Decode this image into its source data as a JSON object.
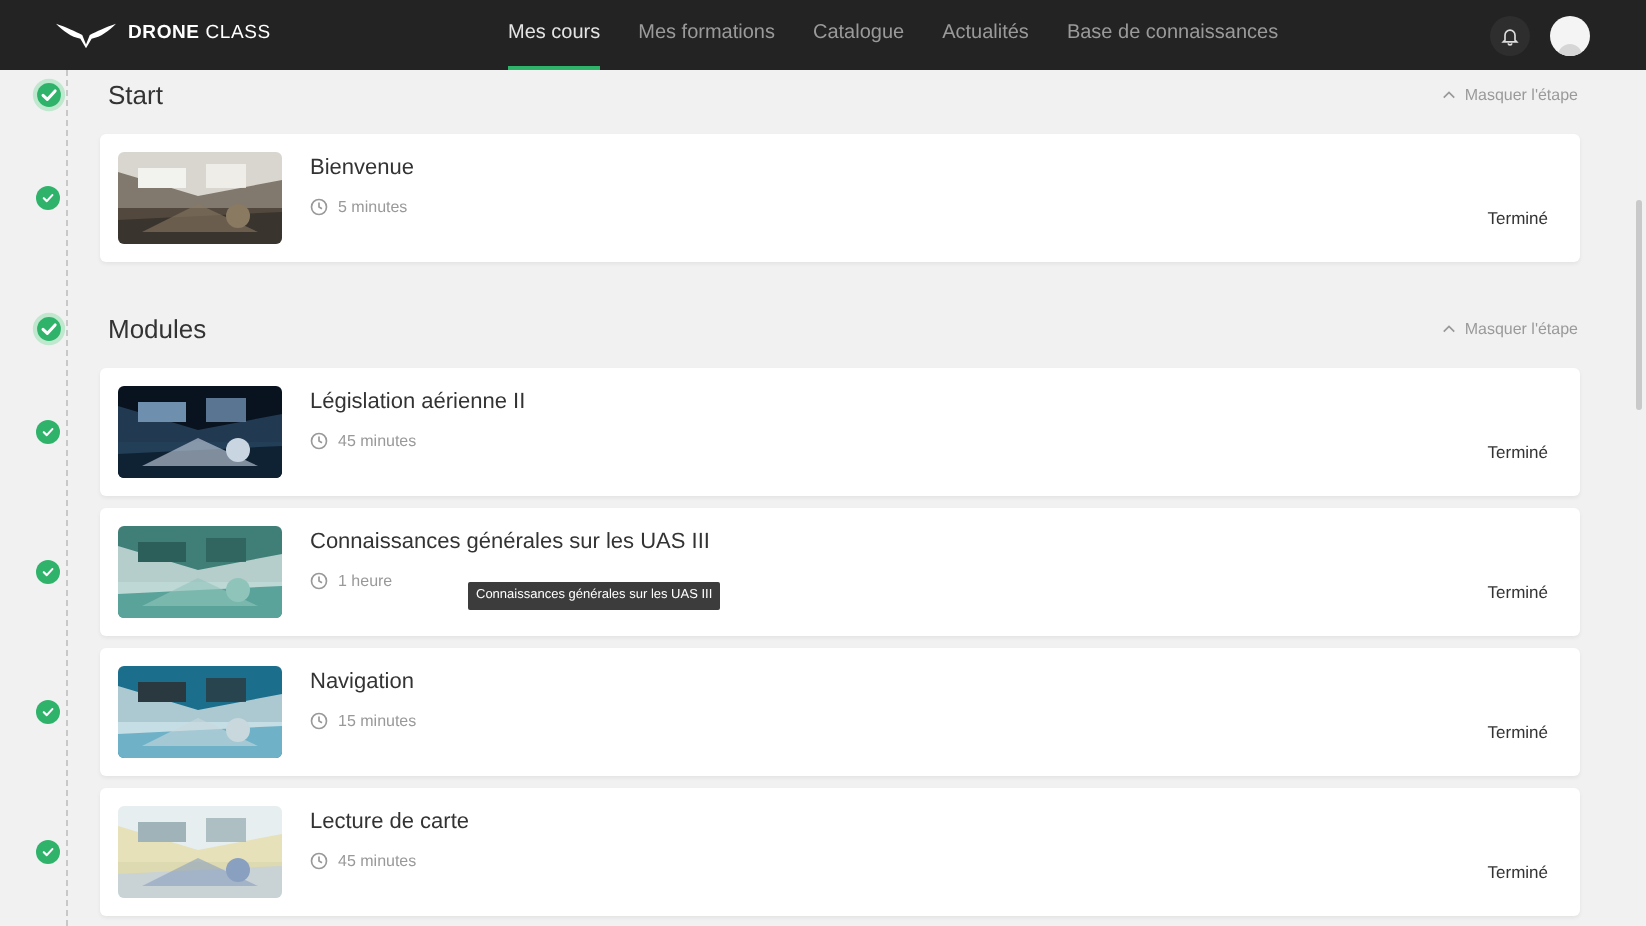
{
  "brand": {
    "bold": "DRONE",
    "light": "CLASS"
  },
  "nav": [
    {
      "label": "Mes cours",
      "selected": true
    },
    {
      "label": "Mes formations",
      "selected": false
    },
    {
      "label": "Catalogue",
      "selected": false
    },
    {
      "label": "Actualités",
      "selected": false
    },
    {
      "label": "Base de connaissances",
      "selected": false
    }
  ],
  "steps": [
    {
      "title": "Start",
      "completed": true,
      "toggle": {
        "label": "Masquer l'étape",
        "expanded": true
      },
      "lessons": [
        {
          "title": "Bienvenue",
          "duration": "5 minutes",
          "status": "Terminé",
          "completed": true
        }
      ]
    },
    {
      "title": "Modules",
      "completed": true,
      "toggle": {
        "label": "Masquer l'étape",
        "expanded": true
      },
      "lessons": [
        {
          "title": "Législation aérienne II",
          "duration": "45 minutes",
          "status": "Terminé",
          "completed": true
        },
        {
          "title": "Connaissances générales sur les UAS III",
          "duration": "1 heure",
          "status": "Terminé",
          "completed": true,
          "tooltip": "Connaissances générales sur les UAS III"
        },
        {
          "title": "Navigation",
          "duration": "15 minutes",
          "status": "Terminé",
          "completed": true
        },
        {
          "title": "Lecture de carte",
          "duration": "45 minutes",
          "status": "Terminé",
          "completed": true
        }
      ]
    }
  ]
}
